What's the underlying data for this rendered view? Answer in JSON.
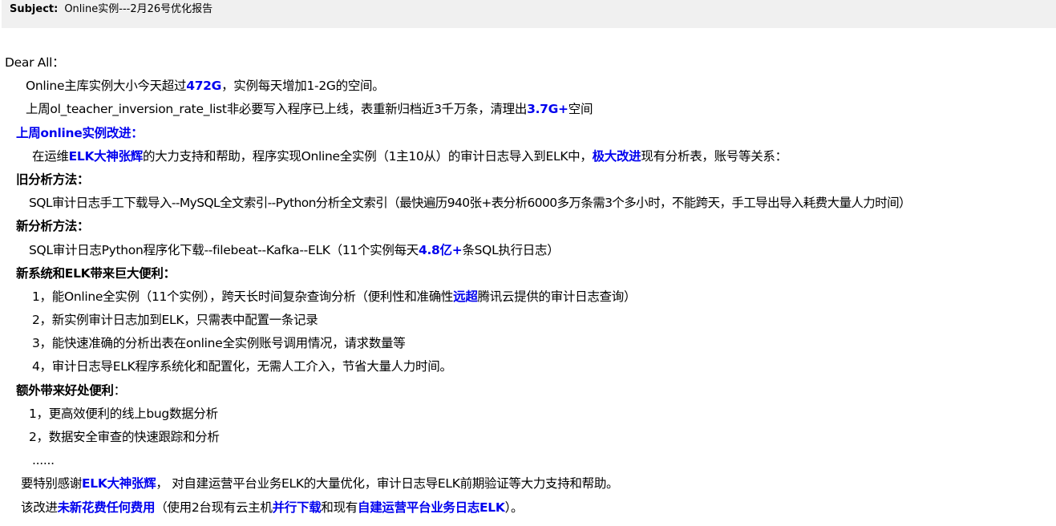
{
  "header": {
    "subject_label": "Subject:",
    "subject_value": "Online实例---2月26号优化报告"
  },
  "body": {
    "greeting": "Dear All：",
    "p1": {
      "a": "Online主库实例大小今天超过",
      "b": "472G",
      "c": "，实例每天增加1-2G的空间。"
    },
    "p2": {
      "a": "上周ol_teacher_inversion_rate_list非必要写入程序已上线，表重新归档近3千万条，清理出",
      "b": "3.7G+",
      "c": "空间"
    },
    "improve_heading": "上周online实例改进：",
    "improve": {
      "a": "在运维",
      "b": "ELK大神张辉",
      "c": "的大力支持和帮助，程序实现Online全实例（1主10从）的审计日志导入到ELK中，",
      "d": "极大改进",
      "e": "现有分析表，账号等关系："
    },
    "old_heading": "旧分析方法：",
    "old_desc": "SQL审计日志手工下载导入--MySQL全文索引--Python分析全文索引（最快遍历940张+表分析6000多万条需3个多小时，不能跨天，手工导出导入耗费大量人力时间）",
    "new_heading": "新分析方法：",
    "new_desc": {
      "a": "SQL审计日志Python程序化下载--filebeat--Kafka--ELK（11个实例每天",
      "b": "4.8亿+",
      "c": "条SQL执行日志）"
    },
    "benefit_heading": "新系统和ELK带来巨大便利：",
    "benefit1": {
      "a": "1，能Online全实例（11个实例），跨天长时间复杂查询分析（便利性和准确性",
      "b": "远超",
      "c": "腾讯云提供的审计日志查询）"
    },
    "benefit2": "2，新实例审计日志加到ELK，只需表中配置一条记录",
    "benefit3": "3，能快速准确的分析出表在online全实例账号调用情况，请求数量等",
    "benefit4": "4，审计日志导ELK程序系统化和配置化，无需人工介入，节省大量人力时间。",
    "extra_heading": "额外带来好处便利",
    "extra_colon": "：",
    "extra1": "1，更高效便利的线上bug数据分析",
    "extra2": "2，数据安全审查的快速跟踪和分析",
    "ellipsis": "......",
    "thanks": {
      "a": "要特别感谢",
      "b": "ELK大神张辉",
      "c": "， 对自建运营平台业务ELK的大量优化，审计日志导ELK前期验证等大力支持和帮助。"
    },
    "cost": {
      "a": "该改进",
      "b": "未新花费任何费用",
      "c": "（使用2台现有云主机",
      "d": "并行下载",
      "e": "和现有",
      "f": "自建运营平台业务日志ELK",
      "g": "）。"
    }
  },
  "colors": {
    "highlight": "#0000ee",
    "subject_bg": "#f0f0f0"
  }
}
